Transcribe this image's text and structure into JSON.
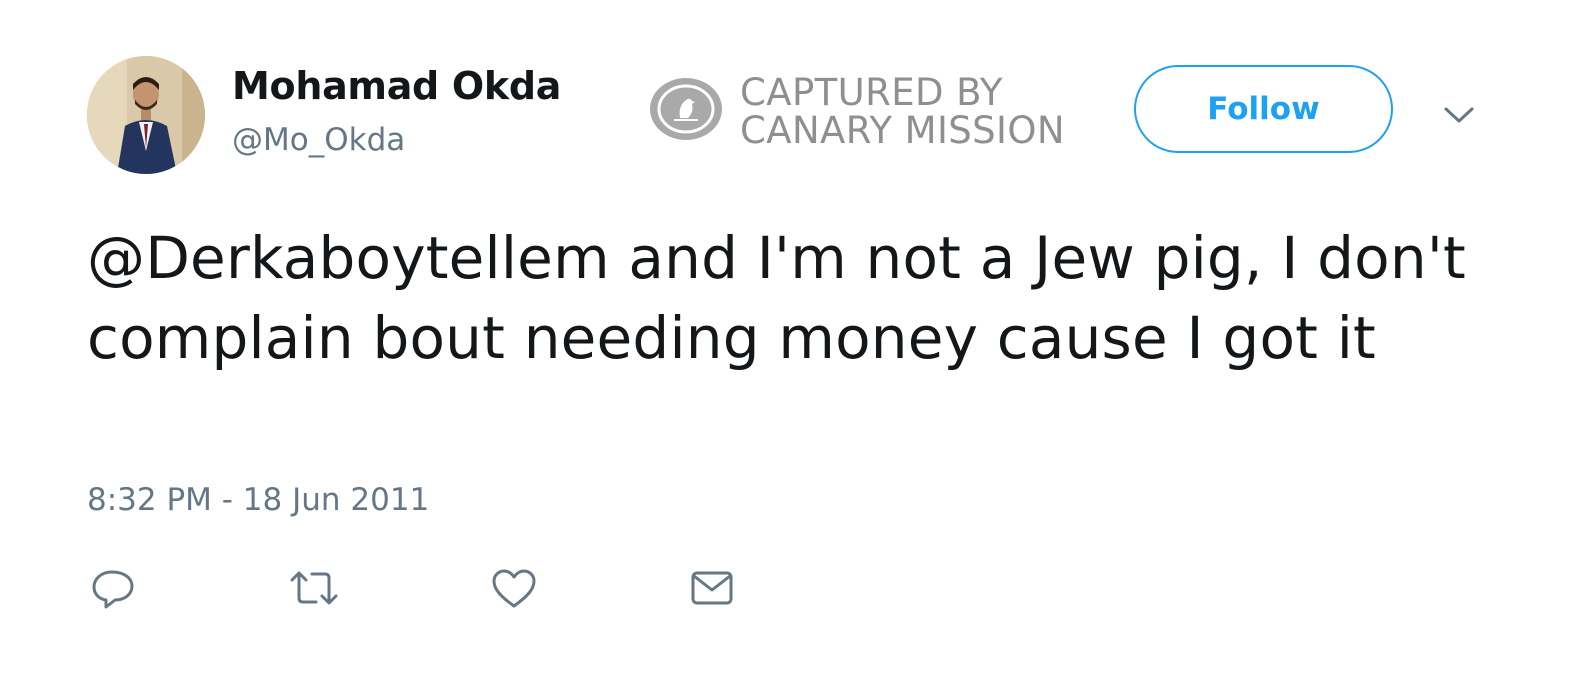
{
  "user": {
    "display_name": "Mohamad Okda",
    "handle": "@Mo_Okda"
  },
  "watermark": {
    "line1": "CAPTURED BY",
    "line2": "CANARY MISSION"
  },
  "follow_button": {
    "label": "Follow"
  },
  "tweet": {
    "text": "@Derkaboytellem and I'm not a Jew pig, I don't complain bout needing money cause I got it",
    "timestamp": "8:32 PM - 18 Jun 2011"
  },
  "actions": [
    {
      "icon": "reply-icon"
    },
    {
      "icon": "retweet-icon"
    },
    {
      "icon": "like-icon"
    },
    {
      "icon": "direct-message-icon"
    }
  ],
  "colors": {
    "accent": "#1da1f2",
    "text": "#14171a",
    "secondary_text": "#657786",
    "watermark": "#8f8f8f"
  }
}
